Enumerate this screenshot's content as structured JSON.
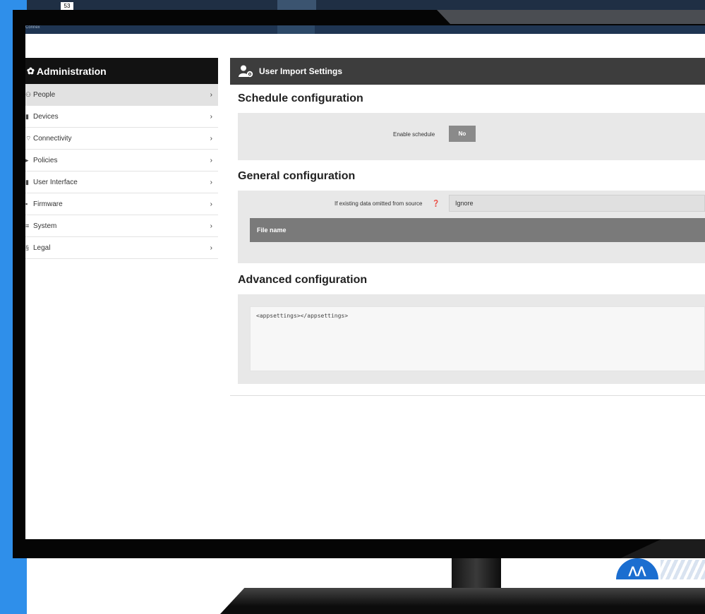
{
  "badge": "53",
  "app_name": "Connex",
  "sidebar": {
    "title": "Administration",
    "items": [
      {
        "label": "People",
        "icon": "people-icon",
        "active": true
      },
      {
        "label": "Devices",
        "icon": "device-icon"
      },
      {
        "label": "Connectivity",
        "icon": "wifi-icon"
      },
      {
        "label": "Policies",
        "icon": "policy-icon"
      },
      {
        "label": "User Interface",
        "icon": "ui-icon"
      },
      {
        "label": "Firmware",
        "icon": "firmware-icon"
      },
      {
        "label": "System",
        "icon": "system-icon"
      },
      {
        "label": "Legal",
        "icon": "legal-icon"
      }
    ]
  },
  "panel": {
    "title": "User Import Settings",
    "schedule": {
      "heading": "Schedule configuration",
      "enable_label": "Enable schedule",
      "enable_value": "No"
    },
    "general": {
      "heading": "General configuration",
      "omitted_label": "If existing data omitted from source",
      "omitted_value": "Ignore",
      "file_name_header": "File name"
    },
    "advanced": {
      "heading": "Advanced configuration",
      "xml_value": "<appsettings></appsettings>"
    }
  },
  "colors": {
    "accent_blue": "#2f8fea",
    "sidebar_header": "#121212",
    "panel_header": "#3d3d3d",
    "toggle_off": "#8a8a8a"
  }
}
